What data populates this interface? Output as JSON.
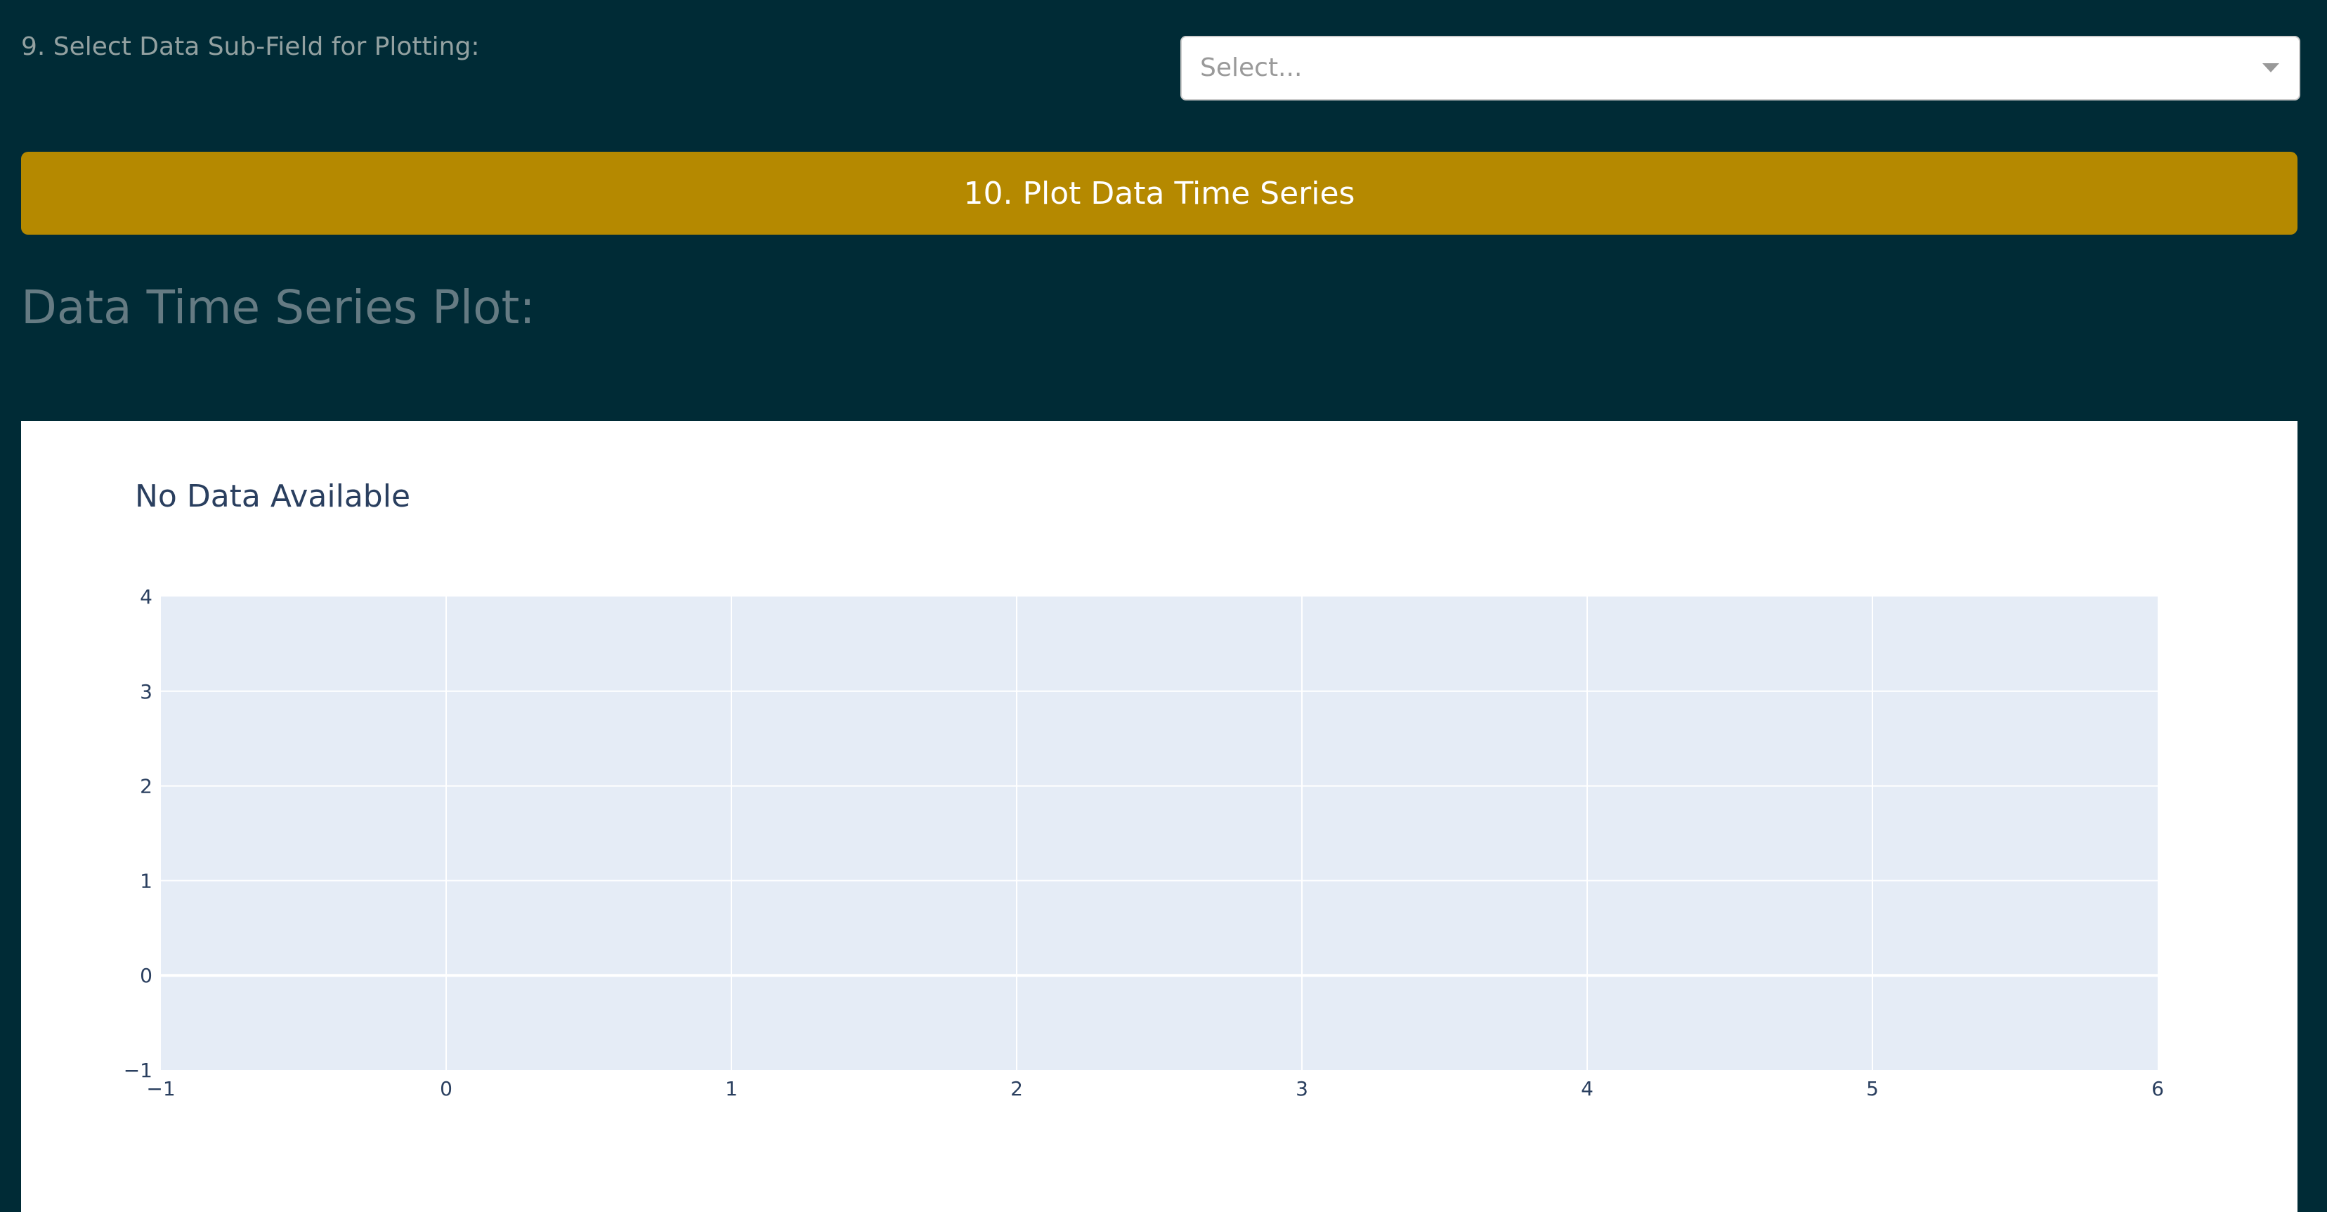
{
  "controls": {
    "subfield_label": "9. Select Data Sub-Field for Plotting:",
    "subfield_select": {
      "placeholder": "Select...",
      "value": ""
    },
    "plot_button_label": "10. Plot Data Time Series"
  },
  "plot_section": {
    "heading": "Data Time Series Plot:"
  },
  "colors": {
    "page_background": "#002b36",
    "button_background": "#b58900",
    "plot_background": "#e5ecf6",
    "axis_text": "#2a3f5f"
  },
  "chart_data": {
    "type": "line",
    "title": "No Data Available",
    "xlabel": "",
    "ylabel": "",
    "series": [],
    "xlim": [
      -1,
      6
    ],
    "ylim": [
      -1,
      4
    ],
    "x_ticks": [
      "−1",
      "0",
      "1",
      "2",
      "3",
      "4",
      "5",
      "6"
    ],
    "y_ticks": [
      "−1",
      "0",
      "1",
      "2",
      "3",
      "4"
    ],
    "grid": true,
    "legend": "none"
  }
}
